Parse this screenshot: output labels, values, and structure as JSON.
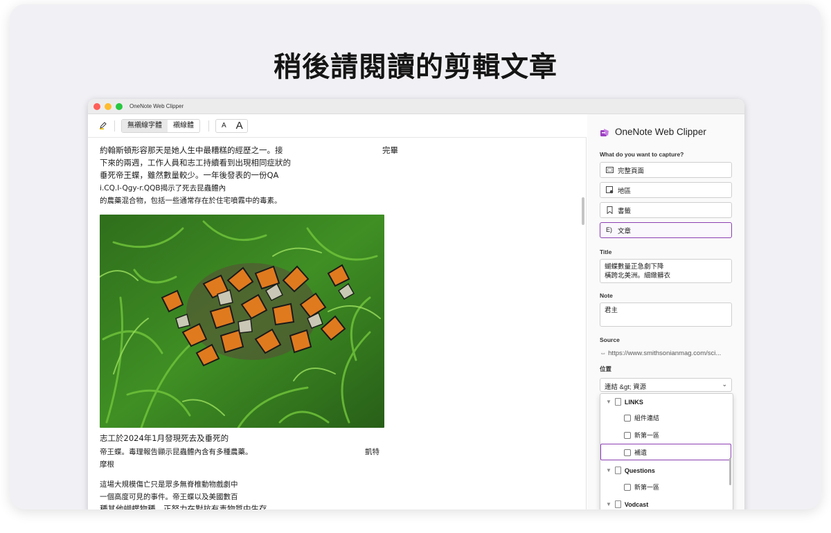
{
  "headline": "稍後請閱讀的剪輯文章",
  "window": {
    "title": "OneNote Web Clipper"
  },
  "toolbar": {
    "font_sans": "無襯線字體",
    "font_serif": "襯線體",
    "size_small": "A",
    "size_large": "A"
  },
  "article": {
    "paragraph1": [
      "約翰斯頓形容那天是她人生中最糟糕的經歷之一。接",
      "下來的兩週，工作人員和志工持續看到出現相同症狀的",
      "垂死帝王蝶，雖然數量較少。一年後發表的一份QA",
      "i.CQ.I-Qgy-r.QQB揭示了死去昆蟲體內",
      "的農藥混合物，包括一些通常存在於住宅噴霧中的毒素。"
    ],
    "paragraph1_tail": "完畢",
    "photo_alt": "monarch butterflies in grass",
    "caption": [
      "志工於2024年1月發現死去及垂死的",
      "帝王蝶。毒理報告顯示昆蟲體內含有多種農藥。"
    ],
    "caption_credit": "凱特",
    "caption_credit2": "摩根",
    "paragraph2": [
      "這場大規模傷亡只是眾多無脊椎動物戲劇中",
      "一個高度可見的事件。帝王蝶以及美國數百",
      "種其他蝴蝶物種，正努力在對抗有毒物質中生存"
    ]
  },
  "panel": {
    "app_name": "OneNote Web Clipper",
    "capture_label": "What do you want to capture?",
    "options": [
      {
        "label": "完整頁面",
        "icon": "full-page-icon"
      },
      {
        "label": "地區",
        "icon": "region-icon"
      },
      {
        "label": "書籤",
        "icon": "bookmark-icon"
      },
      {
        "label": "文章",
        "icon": "article-icon",
        "selected": true
      }
    ],
    "title_label": "Title",
    "title_value": "蝴蝶數量正急劇下降\n橫跨北美洲。細緻髒衣",
    "note_label": "Note",
    "note_value": "君主",
    "source_label": "Source",
    "source_value": "https://www.smithsonianmag.com/sci...",
    "location_label": "位置",
    "location_value": "連結 &gt; 資源",
    "dropdown": {
      "groups": [
        {
          "name": "LINKS",
          "pages": [
            "組件連結",
            "新第一區",
            "補遺"
          ]
        },
        {
          "name": "Questions",
          "pages": [
            "新第一區"
          ]
        },
        {
          "name": "Vodcast",
          "pages": []
        }
      ]
    }
  },
  "colors": {
    "accent": "#8b3fb2",
    "card_bg": "#f1f1f5"
  }
}
